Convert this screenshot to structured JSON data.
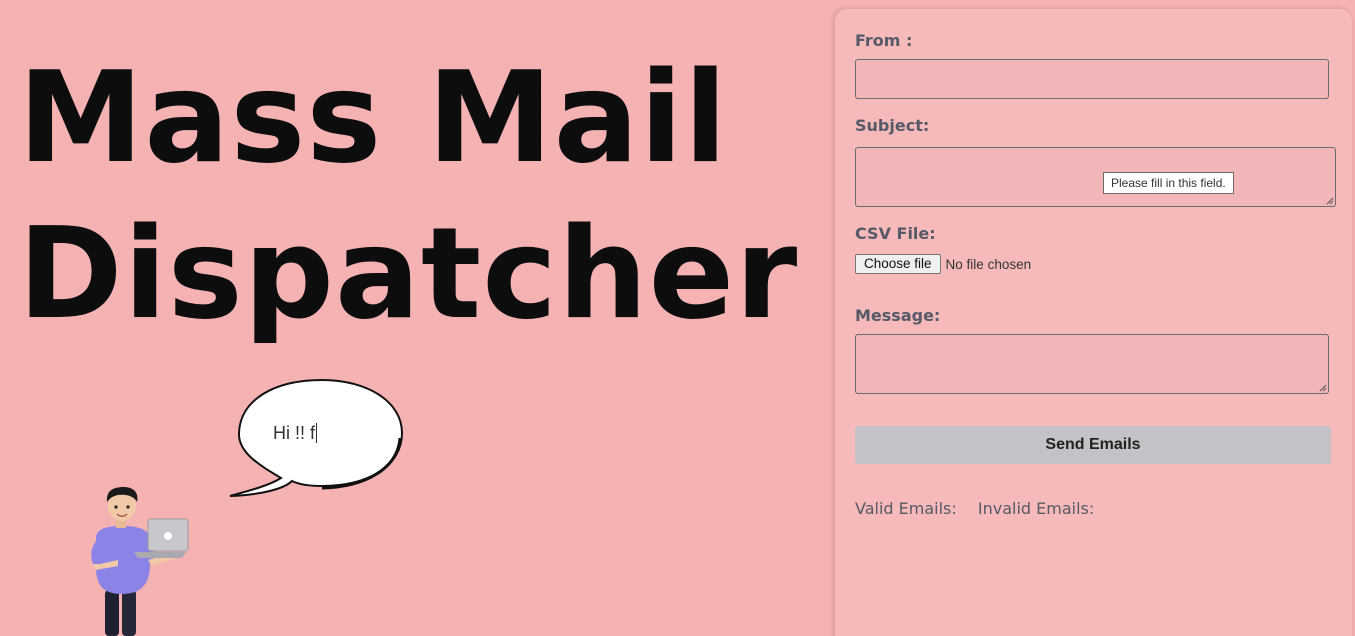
{
  "hero": {
    "title_line1": "Mass Mail",
    "title_line2": "Dispatcher"
  },
  "bubble": {
    "text": "Hi !! f"
  },
  "form": {
    "from_label": "From :",
    "from_value": "",
    "subject_label": "Subject:",
    "subject_value": "",
    "validation_tooltip": "Please fill in this field.",
    "csv_label": "CSV File:",
    "file_button_label": "Choose file",
    "file_status": "No file chosen",
    "message_label": "Message:",
    "message_value": "",
    "send_button_label": "Send Emails",
    "valid_emails_label": "Valid Emails:",
    "invalid_emails_label": "Invalid Emails:"
  },
  "colors": {
    "background": "#f5b2b3",
    "panel": "#f7babb",
    "field": "#f2b6b8",
    "button": "#c4c2c6",
    "title": "#0d0d0d",
    "label": "#555a66"
  },
  "icons": {
    "character": "person-with-laptop-illustration",
    "bubble": "speech-bubble"
  }
}
